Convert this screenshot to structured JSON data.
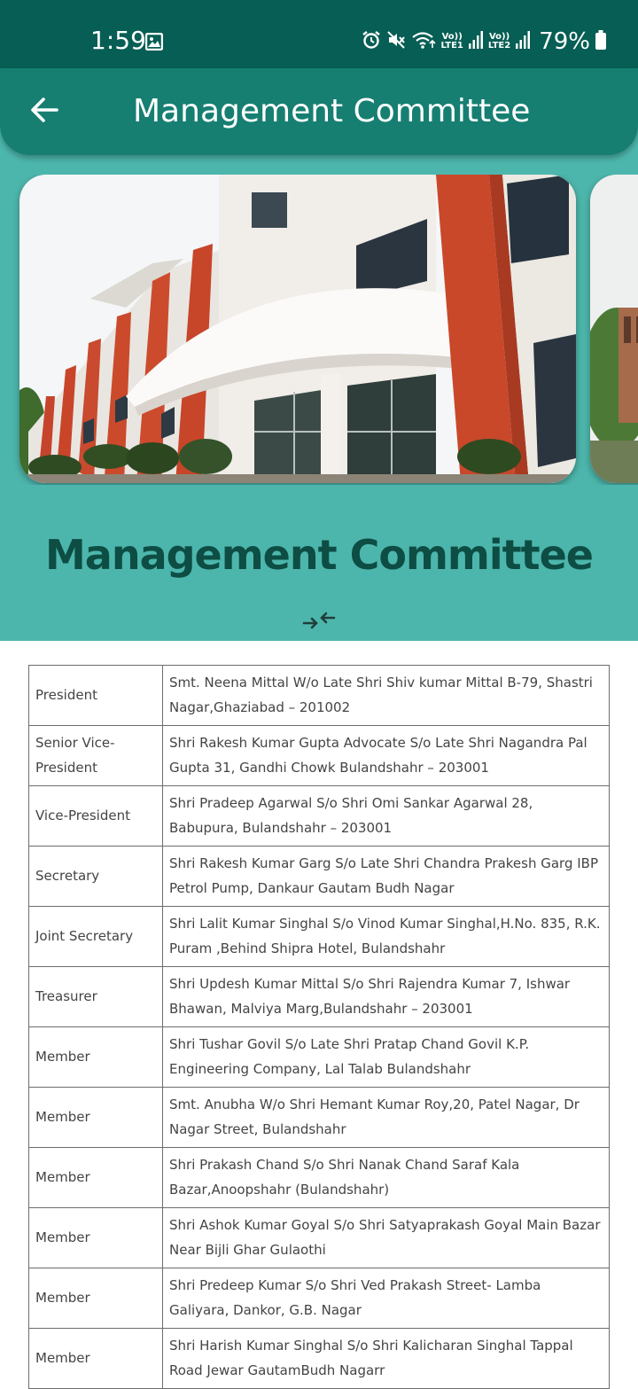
{
  "status_bar": {
    "time": "1:59",
    "sim1": "LTE1",
    "sim2": "LTE2",
    "volte": "Vo))",
    "battery": "79%"
  },
  "app_bar": {
    "title": "Management Committee",
    "back_icon": "arrow-left-icon"
  },
  "heading": "Management Committee",
  "collapse_icon": "collapse-arrows-icon",
  "colors": {
    "status_bar": "#075e54",
    "app_bar": "#167f72",
    "background": "#4db6ac",
    "heading": "#0d4d44"
  },
  "committee": [
    {
      "role": "President",
      "details": "Smt. Neena Mittal W/o Late Shri Shiv kumar Mittal B-79, Shastri Nagar,Ghaziabad – 201002"
    },
    {
      "role": "Senior Vice-President",
      "details": "Shri Rakesh Kumar Gupta Advocate S/o Late Shri Nagandra Pal Gupta 31, Gandhi Chowk Bulandshahr – 203001"
    },
    {
      "role": "Vice-President",
      "details": "Shri Pradeep Agarwal S/o Shri Omi Sankar Agarwal 28, Babupura, Bulandshahr – 203001"
    },
    {
      "role": "Secretary",
      "details": "Shri Rakesh Kumar Garg S/o Late Shri Chandra Prakesh Garg IBP Petrol Pump, Dankaur Gautam Budh Nagar"
    },
    {
      "role": "Joint Secretary",
      "details": "Shri Lalit Kumar Singhal S/o Vinod Kumar Singhal,H.No. 835, R.K. Puram ,Behind Shipra Hotel, Bulandshahr"
    },
    {
      "role": "Treasurer",
      "details": "Shri Updesh Kumar Mittal S/o Shri Rajendra Kumar 7, Ishwar Bhawan, Malviya Marg,Bulandshahr – 203001"
    },
    {
      "role": "Member",
      "details": "Shri Tushar Govil S/o Late Shri Pratap Chand Govil K.P. Engineering Company, Lal Talab Bulandshahr"
    },
    {
      "role": "Member",
      "details": "Smt. Anubha W/o Shri Hemant Kumar Roy,20, Patel Nagar, Dr Nagar Street, Bulandshahr"
    },
    {
      "role": "Member",
      "details": "Shri Prakash Chand S/o Shri Nanak Chand Saraf Kala Bazar,Anoopshahr (Bulandshahr)"
    },
    {
      "role": "Member",
      "details": "Shri Ashok Kumar Goyal S/o Shri Satyaprakash Goyal Main Bazar Near Bijli Ghar Gulaothi"
    },
    {
      "role": "Member",
      "details": "Shri Predeep Kumar S/o Shri Ved Prakash Street- Lamba Galiyara, Dankor, G.B. Nagar"
    },
    {
      "role": "Member",
      "details": "Shri Harish Kumar Singhal S/o Shri Kalicharan Singhal Tappal Road Jewar GautamBudh Nagarr"
    }
  ]
}
